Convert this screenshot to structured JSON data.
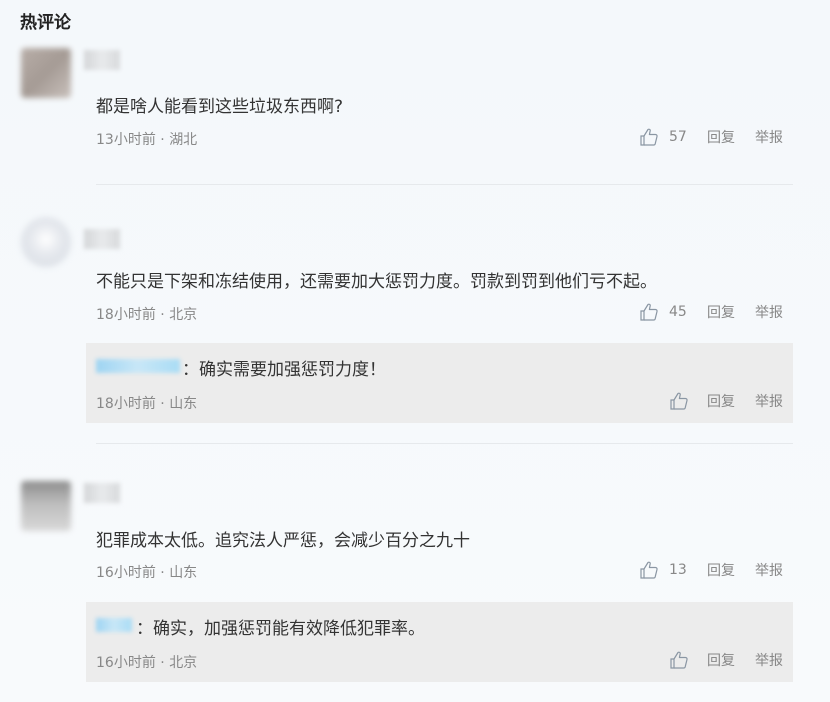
{
  "section_title": "热评论",
  "actions": {
    "reply_label": "回复",
    "report_label": "举报"
  },
  "comments": [
    {
      "text": "都是啥人能看到这些垃圾东西啊?",
      "time": "13小时前",
      "location": "湖北",
      "likes": "57"
    },
    {
      "text": "不能只是下架和冻结使用，还需要加大惩罚力度。罚款到罚到他们亏不起。",
      "time": "18小时前",
      "location": "北京",
      "likes": "45",
      "reply": {
        "text": "：确实需要加强惩罚力度！",
        "time": "18小时前",
        "location": "山东"
      }
    },
    {
      "text": "犯罪成本太低。追究法人严惩，会减少百分之九十",
      "time": "16小时前",
      "location": "山东",
      "likes": "13",
      "reply": {
        "text": "：确实，加强惩罚能有效降低犯罪率。",
        "time": "16小时前",
        "location": "北京"
      }
    }
  ],
  "meta_separator": " · "
}
